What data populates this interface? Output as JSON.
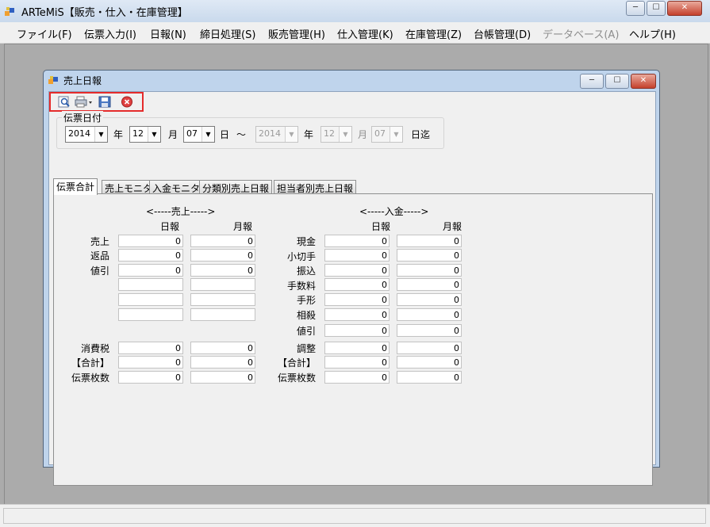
{
  "app": {
    "title": "ARTeMiS【販売・仕入・在庫管理】",
    "controls": {
      "minimize": "─",
      "maximize": "☐",
      "close": "✕"
    }
  },
  "menu": {
    "items": [
      {
        "label": "ファイル(F)",
        "disabled": false
      },
      {
        "label": "伝票入力(I)",
        "disabled": false
      },
      {
        "label": "日報(N)",
        "disabled": false
      },
      {
        "label": "締日処理(S)",
        "disabled": false
      },
      {
        "label": "販売管理(H)",
        "disabled": false
      },
      {
        "label": "仕入管理(K)",
        "disabled": false
      },
      {
        "label": "在庫管理(Z)",
        "disabled": false
      },
      {
        "label": "台帳管理(D)",
        "disabled": false
      },
      {
        "label": "データベース(A)",
        "disabled": true
      },
      {
        "label": "ヘルプ(H)",
        "disabled": false
      }
    ]
  },
  "child": {
    "title": "売上日報",
    "controls": {
      "minimize": "─",
      "maximize": "☐",
      "close": "✕"
    }
  },
  "date_filter": {
    "legend": "伝票日付",
    "from": {
      "year": "2014",
      "month": "12",
      "day": "07"
    },
    "to": {
      "year": "2014",
      "month": "12",
      "day": "07"
    },
    "labels": {
      "year": "年",
      "month": "月",
      "day": "日",
      "range": "～",
      "until": "日迄"
    }
  },
  "tabs": [
    {
      "label": "伝票合計",
      "active": true
    },
    {
      "label": "売上モニタ",
      "active": false
    },
    {
      "label": "入金モニタ",
      "active": false
    },
    {
      "label": "分類別売上日報",
      "active": false
    },
    {
      "label": "担当者別売上日報",
      "active": false
    }
  ],
  "sales": {
    "section_title": "<-----売上----->",
    "col_daily": "日報",
    "col_monthly": "月報",
    "rows": [
      {
        "label": "売上",
        "daily": "0",
        "monthly": "0"
      },
      {
        "label": "返品",
        "daily": "0",
        "monthly": "0"
      },
      {
        "label": "値引",
        "daily": "0",
        "monthly": "0"
      },
      {
        "label": "",
        "daily": "",
        "monthly": ""
      },
      {
        "label": "",
        "daily": "",
        "monthly": ""
      },
      {
        "label": "",
        "daily": "",
        "monthly": ""
      },
      {
        "label": "消費税",
        "daily": "0",
        "monthly": "0"
      },
      {
        "label": "【合計】",
        "daily": "0",
        "monthly": "0"
      },
      {
        "label": "伝票枚数",
        "daily": "0",
        "monthly": "0"
      }
    ]
  },
  "receipts": {
    "section_title": "<-----入金----->",
    "col_daily": "日報",
    "col_monthly": "月報",
    "rows": [
      {
        "label": "現金",
        "daily": "0",
        "monthly": "0"
      },
      {
        "label": "小切手",
        "daily": "0",
        "monthly": "0"
      },
      {
        "label": "振込",
        "daily": "0",
        "monthly": "0"
      },
      {
        "label": "手数料",
        "daily": "0",
        "monthly": "0"
      },
      {
        "label": "手形",
        "daily": "0",
        "monthly": "0"
      },
      {
        "label": "相殺",
        "daily": "0",
        "monthly": "0"
      },
      {
        "label": "値引",
        "daily": "0",
        "monthly": "0"
      },
      {
        "label": "調整",
        "daily": "0",
        "monthly": "0"
      },
      {
        "label": "【合計】",
        "daily": "0",
        "monthly": "0"
      },
      {
        "label": "伝票枚数",
        "daily": "0",
        "monthly": "0"
      }
    ]
  },
  "toolbar": {
    "icons": [
      "preview-icon",
      "print-icon",
      "save-icon",
      "close-form-icon"
    ],
    "accent": "#e52b2b"
  }
}
